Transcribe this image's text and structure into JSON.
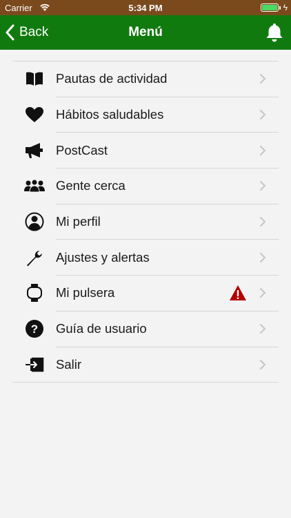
{
  "status_bar": {
    "carrier": "Carrier",
    "time": "5:34 PM"
  },
  "nav": {
    "back_label": "Back",
    "title": "Menú"
  },
  "colors": {
    "status_bar_bg": "#7a4a1d",
    "nav_bg": "#117a0f",
    "background": "#f3f3f3",
    "warning": "#b30000"
  },
  "menu": {
    "items": [
      {
        "label": "Pautas de actividad",
        "icon": "book-icon"
      },
      {
        "label": "Hábitos saludables",
        "icon": "heart-icon"
      },
      {
        "label": "PostCast",
        "icon": "megaphone-icon"
      },
      {
        "label": "Gente cerca",
        "icon": "people-icon"
      },
      {
        "label": "Mi perfil",
        "icon": "user-profile-icon"
      },
      {
        "label": "Ajustes y alertas",
        "icon": "wrench-icon"
      },
      {
        "label": "Mi pulsera",
        "icon": "wristband-icon",
        "badge": "warning-icon"
      },
      {
        "label": "Guía de usuario",
        "icon": "help-icon"
      },
      {
        "label": "Salir",
        "icon": "logout-icon"
      }
    ]
  }
}
